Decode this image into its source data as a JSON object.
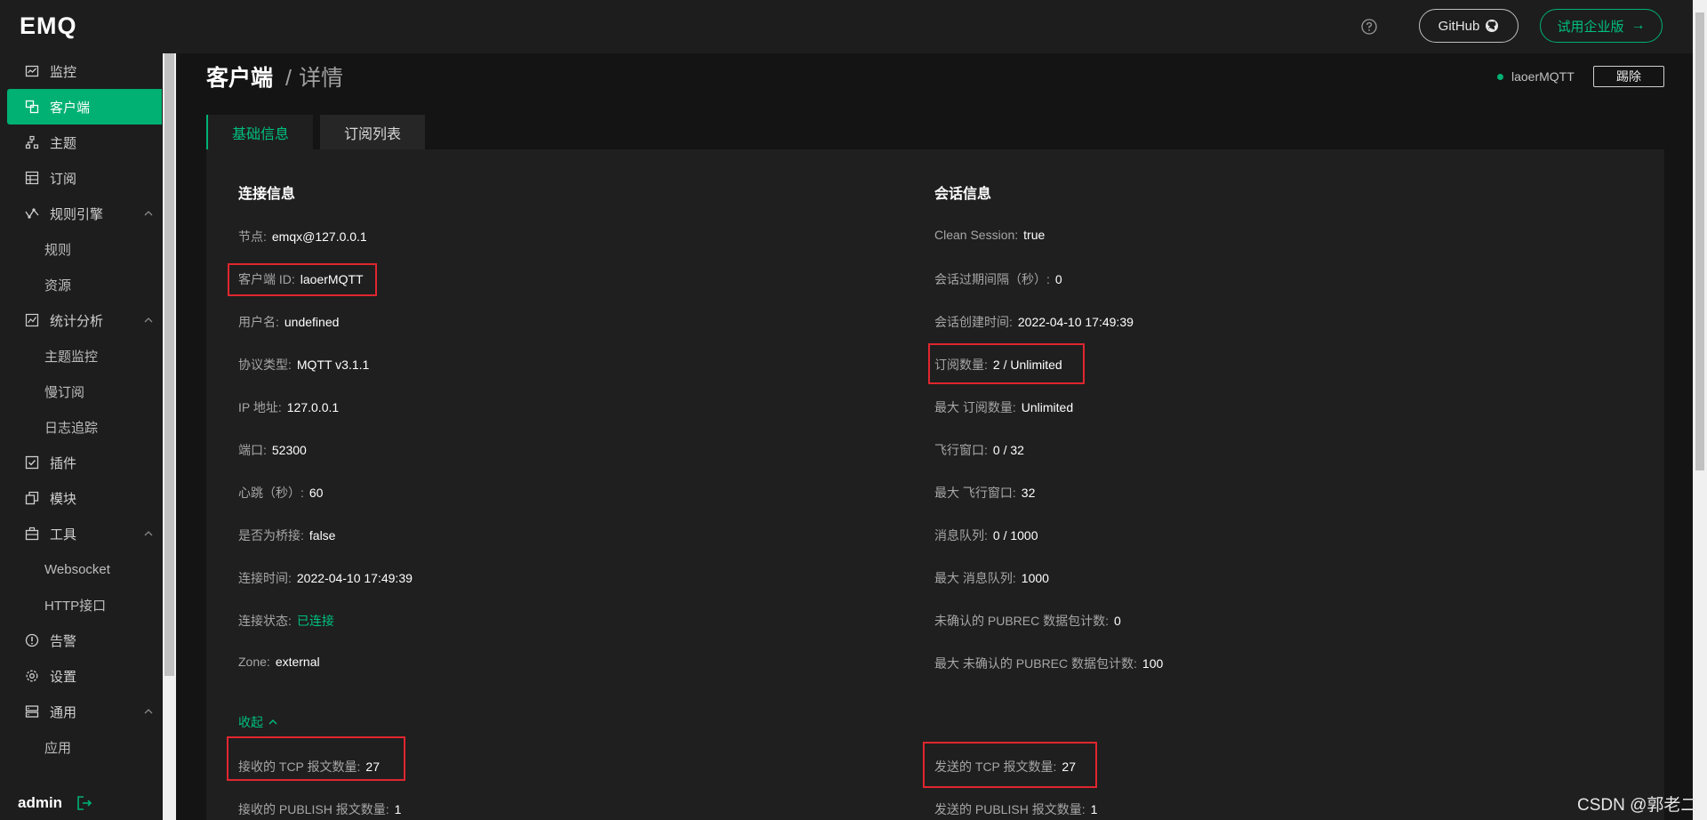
{
  "brand": {
    "logo": "EMQ"
  },
  "sidebar": {
    "items": [
      {
        "label": "监控"
      },
      {
        "label": "客户端"
      },
      {
        "label": "主题"
      },
      {
        "label": "订阅"
      },
      {
        "label": "规则引擎"
      },
      {
        "label": "规则"
      },
      {
        "label": "资源"
      },
      {
        "label": "统计分析"
      },
      {
        "label": "主题监控"
      },
      {
        "label": "慢订阅"
      },
      {
        "label": "日志追踪"
      },
      {
        "label": "插件"
      },
      {
        "label": "模块"
      },
      {
        "label": "工具"
      },
      {
        "label": "Websocket"
      },
      {
        "label": "HTTP接口"
      },
      {
        "label": "告警"
      },
      {
        "label": "设置"
      },
      {
        "label": "通用"
      },
      {
        "label": "应用"
      }
    ],
    "user": "admin"
  },
  "header": {
    "github_label": "GitHub",
    "enterprise_label": "试用企业版"
  },
  "breadcrumb": {
    "main": "客户端",
    "sep": "/",
    "sub": "详情"
  },
  "client": {
    "id_label": "laoerMQTT",
    "kick_label": "踢除"
  },
  "tabs": [
    {
      "label": "基础信息"
    },
    {
      "label": "订阅列表"
    }
  ],
  "connection": {
    "title": "连接信息",
    "fields": [
      {
        "label": "节点:",
        "value": "emqx@127.0.0.1"
      },
      {
        "label": "客户端 ID:",
        "value": "laoerMQTT"
      },
      {
        "label": "用户名:",
        "value": "undefined"
      },
      {
        "label": "协议类型:",
        "value": "MQTT v3.1.1"
      },
      {
        "label": "IP 地址:",
        "value": "127.0.0.1"
      },
      {
        "label": "端口:",
        "value": "52300"
      },
      {
        "label": "心跳（秒）:",
        "value": "60"
      },
      {
        "label": "是否为桥接:",
        "value": "false"
      },
      {
        "label": "连接时间:",
        "value": "2022-04-10 17:49:39"
      },
      {
        "label": "连接状态:",
        "value": "已连接"
      },
      {
        "label": "Zone:",
        "value": "external"
      }
    ]
  },
  "session": {
    "title": "会话信息",
    "fields": [
      {
        "label": "Clean Session:",
        "value": "true"
      },
      {
        "label": "会话过期间隔（秒）:",
        "value": "0"
      },
      {
        "label": "会话创建时间:",
        "value": "2022-04-10 17:49:39"
      },
      {
        "label": "订阅数量:",
        "value": "2 / Unlimited"
      },
      {
        "label": "最大 订阅数量:",
        "value": "Unlimited"
      },
      {
        "label": "飞行窗口:",
        "value": "0 / 32"
      },
      {
        "label": "最大 飞行窗口:",
        "value": "32"
      },
      {
        "label": "消息队列:",
        "value": "0 / 1000"
      },
      {
        "label": "最大 消息队列:",
        "value": "1000"
      },
      {
        "label": "未确认的 PUBREC 数据包计数:",
        "value": "0"
      },
      {
        "label": "最大 未确认的 PUBREC 数据包计数:",
        "value": "100"
      }
    ]
  },
  "collapse_label": "收起",
  "stats": {
    "recv_tcp": {
      "label": "接收的 TCP 报文数量:",
      "value": "27"
    },
    "sent_tcp": {
      "label": "发送的 TCP 报文数量:",
      "value": "27"
    },
    "recv_publish": {
      "label": "接收的 PUBLISH 报文数量:",
      "value": "1"
    },
    "sent_publish": {
      "label": "发送的 PUBLISH 报文数量:",
      "value": "1"
    }
  },
  "watermark": "CSDN @郭老二"
}
